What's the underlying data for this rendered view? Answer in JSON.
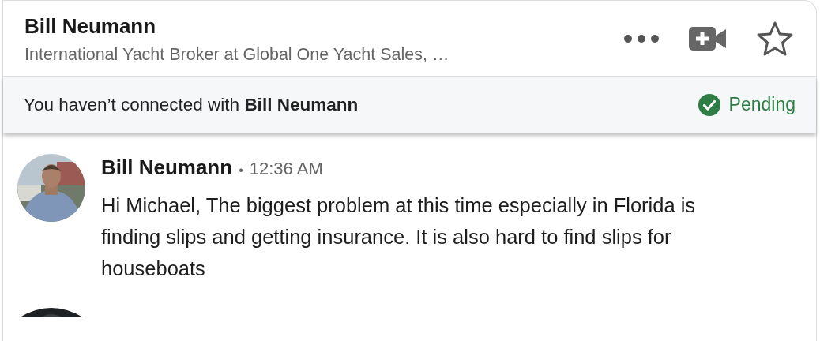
{
  "header": {
    "name": "Bill Neumann",
    "headline": "International Yacht Broker at Global One Yacht Sales, …",
    "actions": [
      {
        "kind": "more"
      },
      {
        "kind": "video"
      },
      {
        "kind": "star"
      }
    ]
  },
  "banner": {
    "text": "You haven’t connected with **Bill Neumann**",
    "status": "Pending"
  },
  "messages": [
    {
      "sender": "Bill Neumann",
      "separator": "•",
      "time": "12:36 AM",
      "text": "Hi Michael, The biggest problem at this time especially in Florida is finding slips and getting insurance. It is also hard to find slips for houseboats"
    }
  ]
}
